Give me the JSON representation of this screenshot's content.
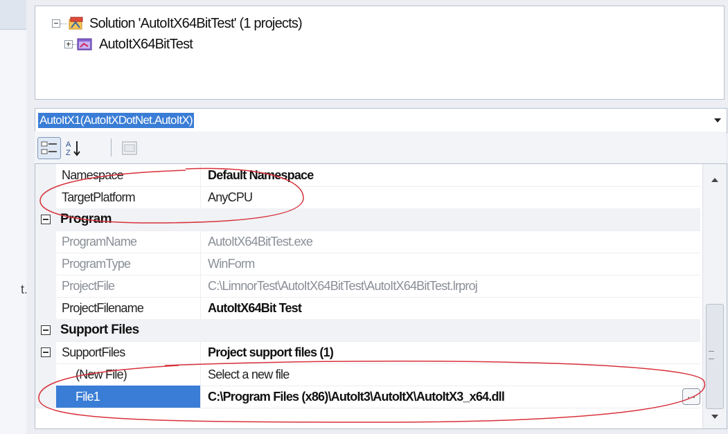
{
  "left_panel": {
    "fragment_text": "t."
  },
  "solution_explorer": {
    "solution_label": "Solution 'AutoItX64BitTest' (1 projects)",
    "project_label": "AutoItX64BitTest"
  },
  "object_selector": {
    "selected": "AutoItX1(AutoItXDotNet.AutoItX)"
  },
  "toolbar": {
    "buttons": [
      "categorized-icon",
      "alphabetical-icon",
      "property-pages-icon"
    ]
  },
  "property_grid": {
    "rows": [
      {
        "name": "Namespace",
        "value": "Default Namespace"
      },
      {
        "name": "TargetPlatform",
        "value": "AnyCPU"
      }
    ],
    "category_program": "Program",
    "program_rows": [
      {
        "name": "ProgramName",
        "value": "AutoItX64BitTest.exe"
      },
      {
        "name": "ProgramType",
        "value": "WinForm"
      },
      {
        "name": "ProjectFile",
        "value": "C:\\LimnorTest\\AutoItX64BitTest\\AutoItX64BitTest.lrproj"
      },
      {
        "name": "ProjectFilename",
        "value": "AutoItX64Bit Test"
      }
    ],
    "category_support": "Support Files",
    "support_rows": [
      {
        "name": "SupportFiles",
        "value": "Project support files (1)"
      },
      {
        "name": "(New File)",
        "value": "Select a new file"
      },
      {
        "name": "File1",
        "value": "C:\\Program Files (x86)\\AutoIt3\\AutoItX\\AutoItX3_x64.dll"
      }
    ],
    "ellipsis_label": "..."
  },
  "annotations": {
    "color": "#d8303a"
  }
}
